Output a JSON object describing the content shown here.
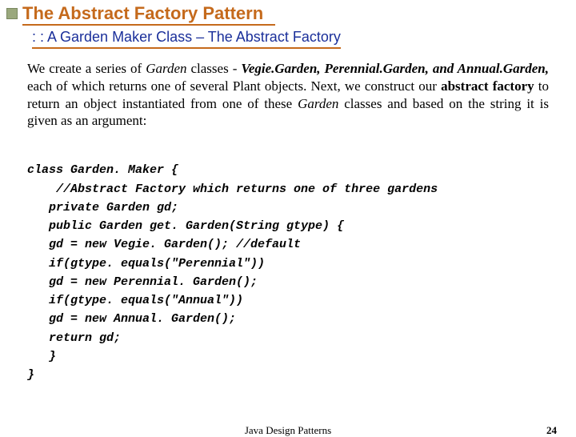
{
  "title": "The Abstract Factory Pattern",
  "subtitle": ": : A Garden Maker Class – The Abstract Factory",
  "para": {
    "p1": "We create a series of ",
    "p2": "Garden",
    "p3": " classes - ",
    "p4": "Vegie.Garden, Perennial.Garden, and Annual.Garden,",
    "p5": " each of which returns one of several Plant objects. Next, we construct our ",
    "p6": "abstract factory",
    "p7": " to return an object instantiated from one of these ",
    "p8": "Garden",
    "p9": " classes  and based on the string it is given as an argument:"
  },
  "code": {
    "l1": "class Garden. Maker {",
    "l2": "    //Abstract Factory which returns one of three gardens",
    "l3": "   private Garden gd;",
    "l4": "   public Garden get. Garden(String gtype) {",
    "l5": "   gd = new Vegie. Garden(); //default",
    "l6": "   if(gtype. equals(\"Perennial\"))",
    "l7": "   gd = new Perennial. Garden();",
    "l8": "   if(gtype. equals(\"Annual\"))",
    "l9": "   gd = new Annual. Garden();",
    "l10": "   return gd;",
    "l11": "   }",
    "l12": "}"
  },
  "footer": {
    "center": "Java Design Patterns",
    "page": "24"
  }
}
